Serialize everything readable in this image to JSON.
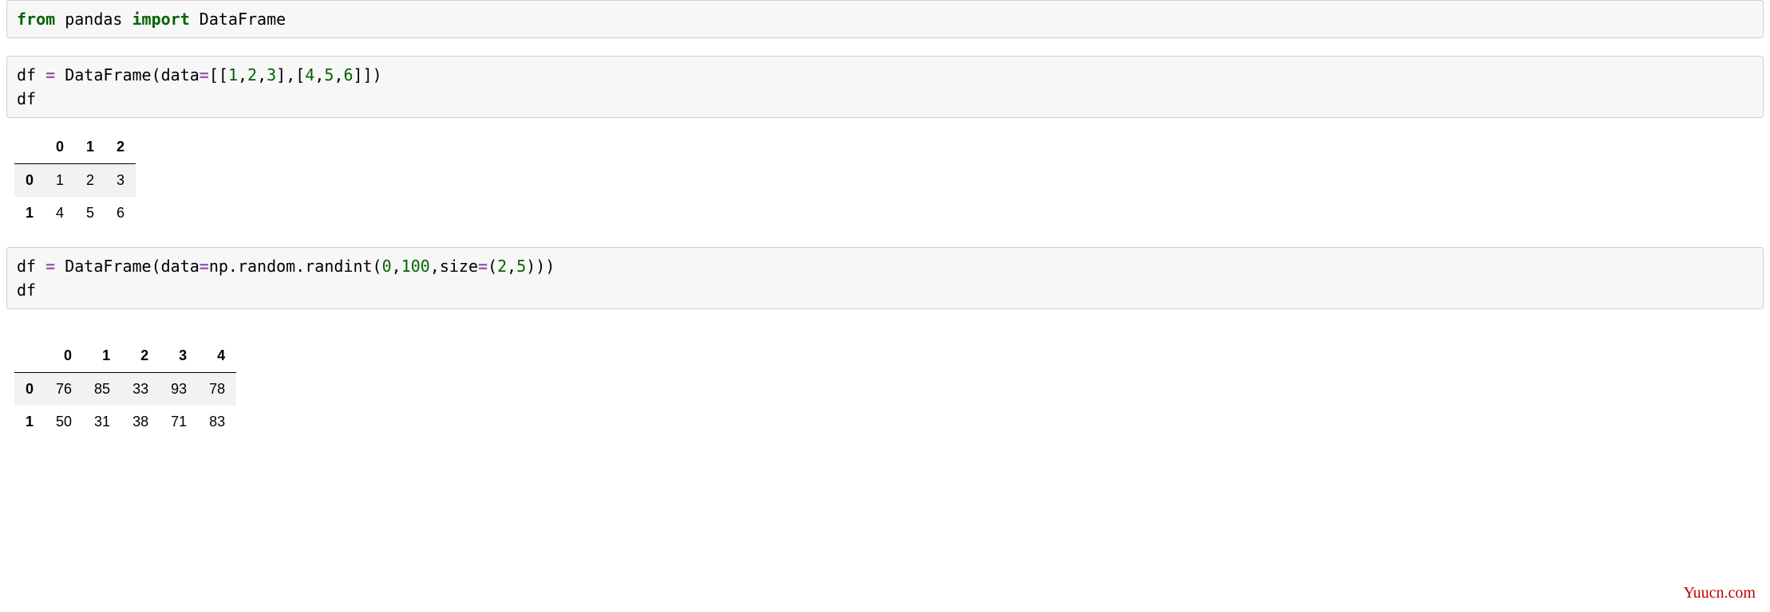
{
  "code_cells": {
    "cell1": {
      "kw_from": "from",
      "pkg": " pandas ",
      "kw_import": "import",
      "obj": " DataFrame"
    },
    "cell2": {
      "line1_a": "df ",
      "line1_op": "=",
      "line1_b": " DataFrame(data",
      "line1_op2": "=",
      "line1_c": "[[",
      "n1": "1",
      "c1": ",",
      "n2": "2",
      "c2": ",",
      "n3": "3",
      "c3": "],[",
      "n4": "4",
      "c4": ",",
      "n5": "5",
      "c5": ",",
      "n6": "6",
      "c6": "]])",
      "line2": "df"
    },
    "cell3": {
      "line1_a": "df ",
      "op1": "=",
      "line1_b": " DataFrame(data",
      "op2": "=",
      "line1_c": "np.random.randint(",
      "n1": "0",
      "c1": ",",
      "n2": "100",
      "c2": ",size",
      "op3": "=",
      "c3": "(",
      "n3": "2",
      "c4": ",",
      "n4": "5",
      "c5": ")))",
      "line2": "df"
    }
  },
  "tables": {
    "t1": {
      "columns": [
        "0",
        "1",
        "2"
      ],
      "index": [
        "0",
        "1"
      ],
      "rows": [
        [
          "1",
          "2",
          "3"
        ],
        [
          "4",
          "5",
          "6"
        ]
      ]
    },
    "t2": {
      "columns": [
        "0",
        "1",
        "2",
        "3",
        "4"
      ],
      "index": [
        "0",
        "1"
      ],
      "rows": [
        [
          "76",
          "85",
          "33",
          "93",
          "78"
        ],
        [
          "50",
          "31",
          "38",
          "71",
          "83"
        ]
      ]
    }
  },
  "watermark": "Yuucn.com"
}
